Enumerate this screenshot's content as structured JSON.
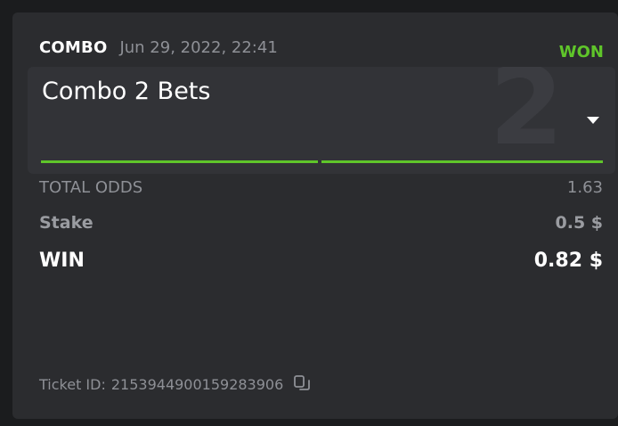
{
  "bet": {
    "type": "COMBO",
    "date": "Jun 29, 2022, 22:41",
    "status": "WON"
  },
  "combo": {
    "title": "Combo 2 Bets",
    "count_badge": "2",
    "legs_won": 2,
    "legs_total": 2
  },
  "summary": {
    "total_odds_label": "TOTAL ODDS",
    "total_odds_value": "1.63",
    "stake_label": "Stake",
    "stake_value": "0.5 $",
    "win_label": "WIN",
    "win_value": "0.82 $"
  },
  "ticket": {
    "label": "Ticket ID:",
    "id": "2153944900159283906"
  },
  "colors": {
    "background": "#1b1c1e",
    "card": "#2b2c2f",
    "accent_green": "#5fc52a",
    "muted_text": "#8e9096"
  },
  "icons": {
    "dropdown": "chevron-down-icon",
    "copy": "copy-icon"
  }
}
